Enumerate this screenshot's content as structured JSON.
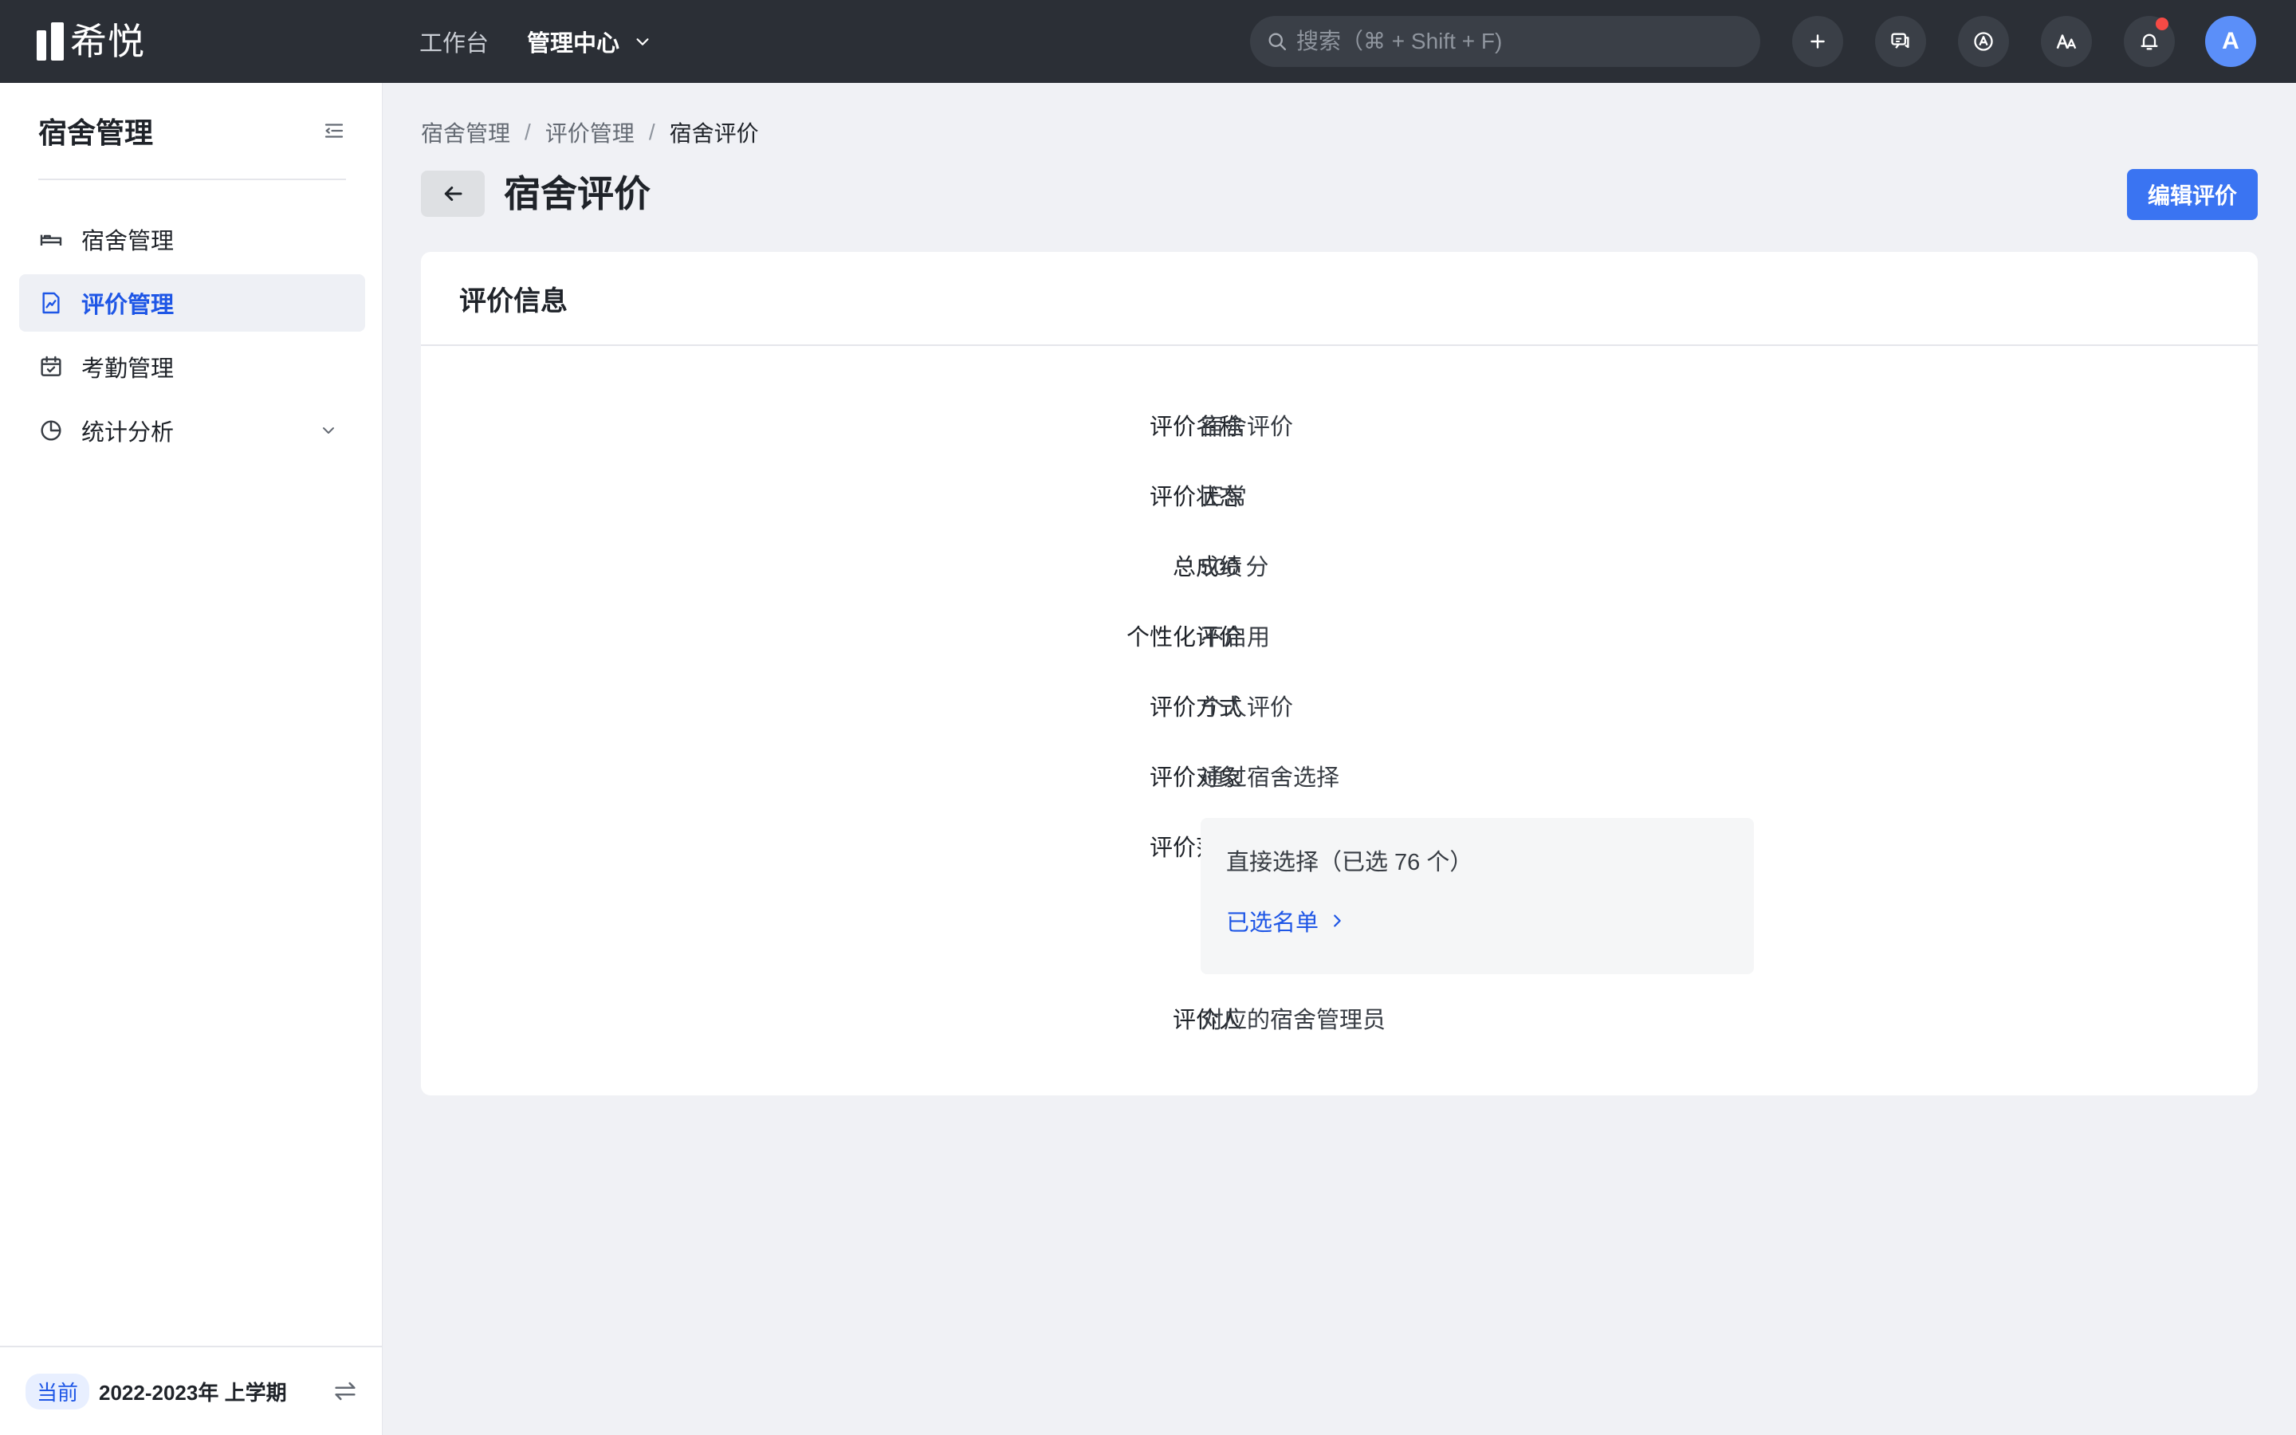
{
  "topbar": {
    "logo_text": "希悦",
    "nav": [
      {
        "label": "工作台"
      },
      {
        "label": "管理中心"
      }
    ],
    "search_placeholder": "搜索（⌘ + Shift + F)",
    "avatar_letter": "A",
    "icons": [
      "plus-icon",
      "feedback-icon",
      "app-center-icon",
      "translate-icon",
      "bell-icon"
    ],
    "notification_dot_color": "#f54a45"
  },
  "sidebar": {
    "title": "宿舍管理",
    "items": [
      {
        "label": "宿舍管理",
        "icon": "bed-icon"
      },
      {
        "label": "评价管理",
        "icon": "evaluation-doc-icon",
        "active": true
      },
      {
        "label": "考勤管理",
        "icon": "calendar-check-icon"
      },
      {
        "label": "统计分析",
        "icon": "pie-chart-icon",
        "expandable": true
      }
    ],
    "footer": {
      "badge": "当前",
      "term": "2022-2023年 上学期"
    }
  },
  "breadcrumb": [
    "宿舍管理",
    "评价管理",
    "宿舍评价"
  ],
  "page": {
    "title": "宿舍评价",
    "edit_button": "编辑评价"
  },
  "card": {
    "title": "评价信息",
    "fields": [
      {
        "label": "评价名称",
        "value": "宿舍评价"
      },
      {
        "label": "评价状态",
        "value": "正常"
      },
      {
        "label": "总成绩",
        "value": "500 分"
      },
      {
        "label": "个性化评价",
        "value": "不启用"
      },
      {
        "label": "评价方式",
        "value": "个人评价"
      },
      {
        "label": "评价对象",
        "value": "通过宿舍选择"
      },
      {
        "label": "评价范围",
        "value": ""
      },
      {
        "label": "评价人",
        "value": "对应的宿舍管理员"
      }
    ],
    "scope": {
      "text": "直接选择（已选 76 个）",
      "link": "已选名单"
    }
  },
  "colors": {
    "accent": "#1e56e6",
    "primary_button": "#3a74f2",
    "topbar": "#2b2f36"
  }
}
